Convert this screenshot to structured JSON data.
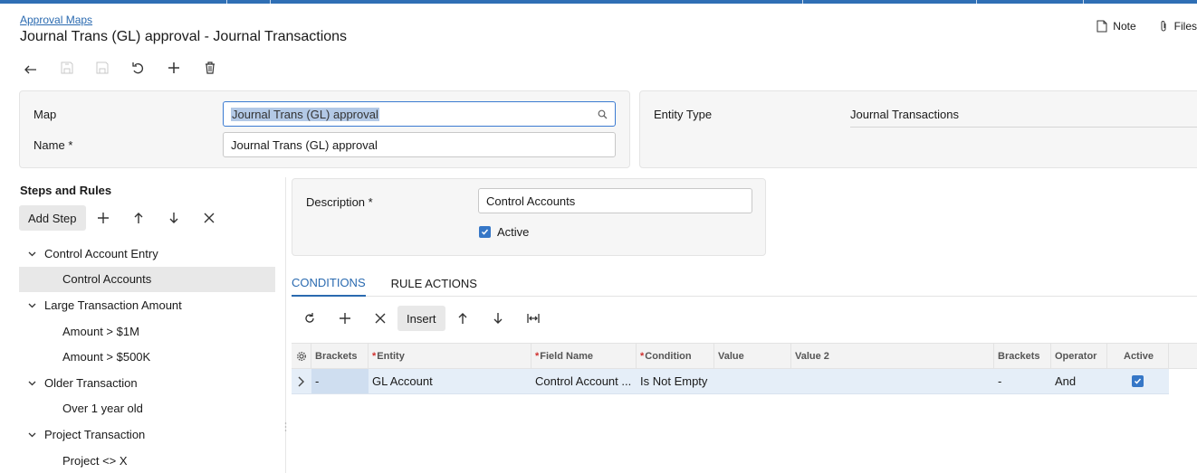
{
  "breadcrumb": "Approval Maps",
  "page_title": "Journal Trans (GL) approval - Journal Transactions",
  "top_actions": {
    "note": "Note",
    "files": "Files"
  },
  "form": {
    "map_label": "Map",
    "map_value": "Journal Trans (GL) approval",
    "name_label": "Name",
    "name_value": "Journal Trans (GL) approval",
    "required_mark": "*",
    "entity_type_label": "Entity Type",
    "entity_type_value": "Journal Transactions"
  },
  "steps": {
    "title": "Steps and Rules",
    "add_step_label": "Add Step",
    "tree": [
      {
        "label": "Control Account Entry",
        "type": "group"
      },
      {
        "label": "Control Accounts",
        "type": "leaf",
        "selected": true
      },
      {
        "label": "Large Transaction Amount",
        "type": "group"
      },
      {
        "label": "Amount > $1M",
        "type": "leaf"
      },
      {
        "label": "Amount > $500K",
        "type": "leaf"
      },
      {
        "label": "Older Transaction",
        "type": "group"
      },
      {
        "label": "Over 1 year old",
        "type": "leaf"
      },
      {
        "label": "Project Transaction",
        "type": "group"
      },
      {
        "label": "Project <> X",
        "type": "leaf"
      }
    ]
  },
  "rule": {
    "description_label": "Description",
    "description_value": "Control Accounts",
    "active_label": "Active",
    "active_checked": true
  },
  "tabs": [
    "CONDITIONS",
    "RULE ACTIONS"
  ],
  "grid": {
    "insert_label": "Insert",
    "headers": [
      "Brackets",
      "Entity",
      "Field Name",
      "Condition",
      "Value",
      "Value 2",
      "Brackets",
      "Operator",
      "Active"
    ],
    "rows": [
      {
        "brackets_open": "-",
        "entity": "GL Account",
        "field_name": "Control Account ...",
        "condition": "Is Not Empty",
        "value": "",
        "value2": "",
        "brackets_close": "-",
        "operator": "And",
        "active": true
      }
    ]
  },
  "colors": {
    "accent": "#2a6ab0",
    "checkbox": "#3677c7",
    "topbar": "#2f6fb5",
    "required": "#d0302e"
  }
}
